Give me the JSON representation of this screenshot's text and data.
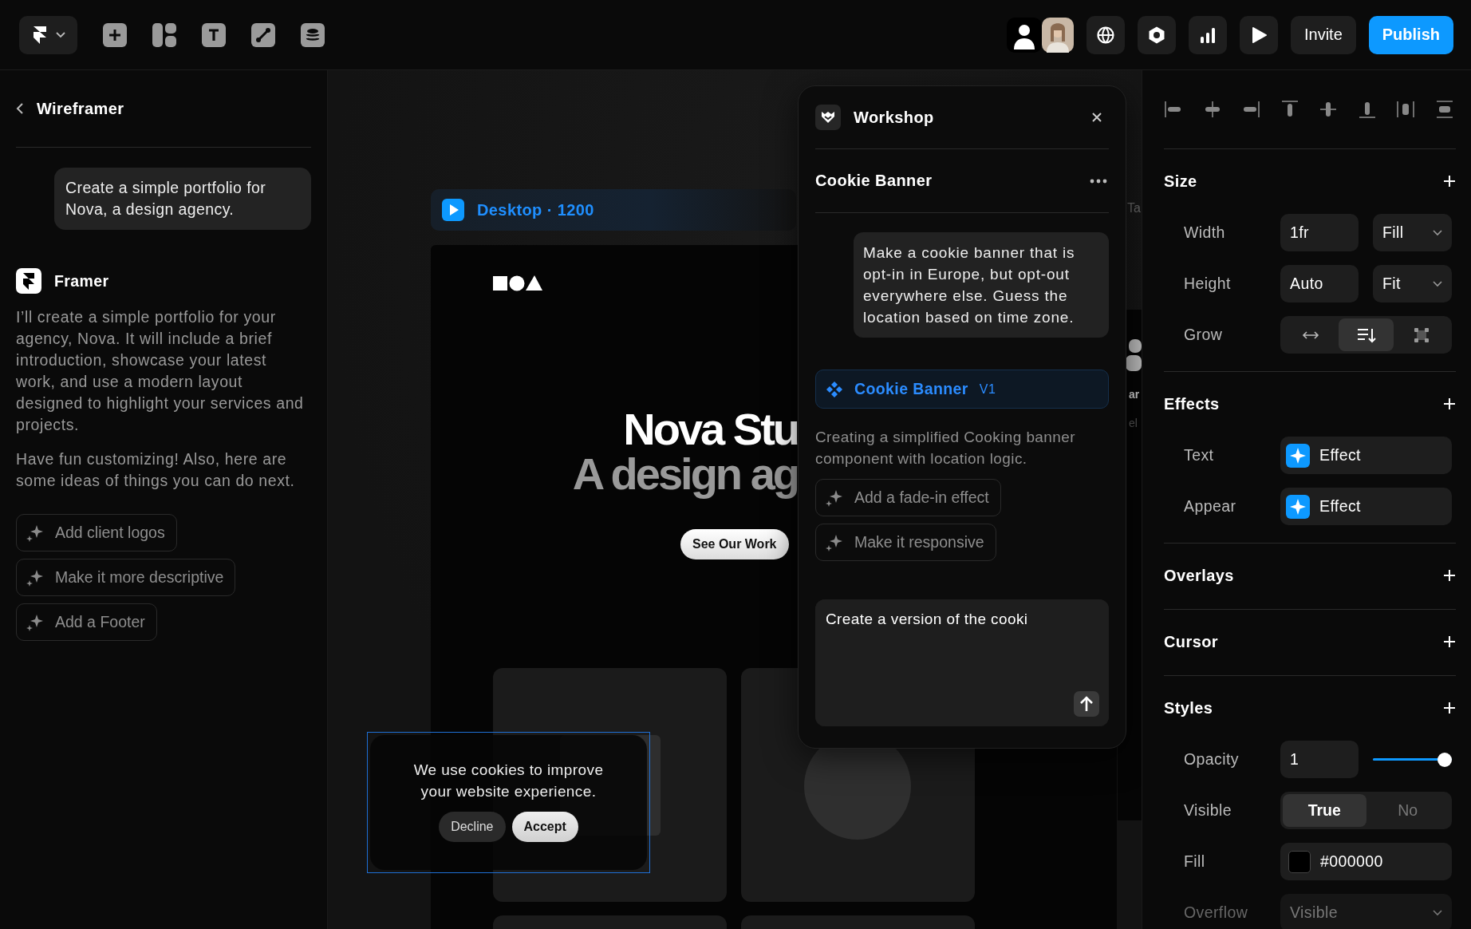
{
  "toolbar": {
    "invite": "Invite",
    "publish": "Publish"
  },
  "left_panel": {
    "title": "Wireframer",
    "user_message": "Create a simple portfolio for Nova, a design agency.",
    "assistant": {
      "name": "Framer",
      "paragraphs": [
        "I’ll create a simple portfolio for your agency, Nova. It will include a brief introduction, showcase your latest work, and use a modern layout designed to highlight your services and projects.",
        "Have fun customizing! Also, here are some ideas of things you can do next."
      ]
    },
    "suggestions": [
      "Add client logos",
      "Make it more descriptive",
      "Add a Footer"
    ]
  },
  "canvas": {
    "frame_label": "Desktop · 1200",
    "next_frame_label": "Ta",
    "hero": {
      "title": "Nova Stu",
      "subtitle": "A design ag",
      "button": "See Our Work"
    },
    "side_texts": [
      "ar",
      "el"
    ],
    "cookie_banner": {
      "message": "We use cookies to improve your website experience.",
      "buttons": [
        {
          "label": "Decline",
          "kind": "secondary"
        },
        {
          "label": "Accept",
          "kind": "primary"
        }
      ]
    }
  },
  "workshop": {
    "title": "Workshop",
    "component_title": "Cookie Banner",
    "user_message": "Make a cookie banner that is opt-in in Europe, but opt-out everywhere else. Guess the location based on time zone.",
    "component": {
      "name": "Cookie Banner",
      "version": "V1"
    },
    "status": "Creating a simplified Cooking banner component with location logic.",
    "suggestions": [
      "Add a fade-in effect",
      "Make it responsive"
    ],
    "prompt": {
      "value": "Create a version of the cooki"
    }
  },
  "properties": {
    "sections": [
      {
        "title": "Size",
        "rows": [
          {
            "kind": "input-select",
            "label": "Width",
            "value": "1fr",
            "option": "Fill"
          },
          {
            "kind": "input-select",
            "label": "Height",
            "value": "Auto",
            "option": "Fit"
          },
          {
            "kind": "icons",
            "label": "Grow",
            "options": [
              {
                "selected": false
              },
              {
                "selected": true
              },
              {
                "selected": false
              }
            ]
          }
        ]
      },
      {
        "title": "Effects",
        "rows": [
          {
            "kind": "effect",
            "label": "Text",
            "value": "Effect"
          },
          {
            "kind": "effect",
            "label": "Appear",
            "value": "Effect"
          }
        ]
      },
      {
        "title": "Overlays"
      },
      {
        "title": "Cursor"
      },
      {
        "title": "Styles",
        "rows": [
          {
            "kind": "slider",
            "label": "Opacity",
            "value": "1",
            "level": 1
          },
          {
            "kind": "toggle",
            "label": "Visible",
            "options": [
              {
                "label": "True",
                "selected": true
              },
              {
                "label": "No",
                "selected": false
              }
            ]
          },
          {
            "kind": "color",
            "label": "Fill",
            "value": "#000000"
          },
          {
            "kind": "select",
            "label": "Overflow",
            "value": "Visible",
            "disabled": true
          }
        ]
      }
    ]
  }
}
